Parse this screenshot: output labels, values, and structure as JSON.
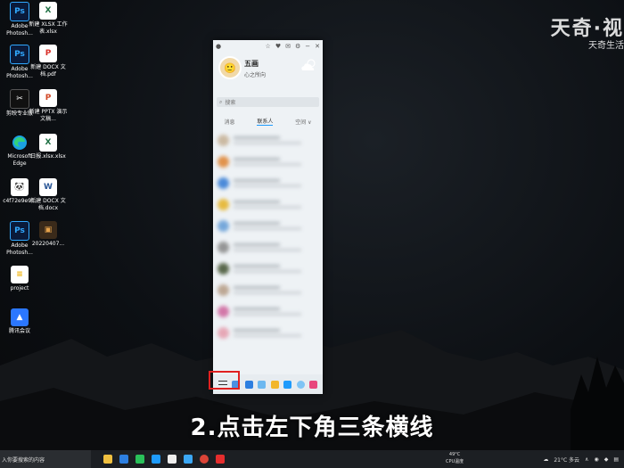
{
  "desktop": {
    "icons": [
      {
        "label": "Adobe Photosh...",
        "icon": "photoshop-icon",
        "glyph": "Ps"
      },
      {
        "label": "新建 XLSX 工作表.xlsx",
        "icon": "excel-file-icon",
        "glyph": "X"
      },
      {
        "label": "Adobe Photosh...",
        "icon": "photoshop-icon",
        "glyph": "Ps"
      },
      {
        "label": "新建 DOCX 文档.pdf",
        "icon": "pdf-file-icon",
        "glyph": "P"
      },
      {
        "label": "剪映专业版",
        "icon": "capcut-icon",
        "glyph": "✂"
      },
      {
        "label": "新建 PPTX 演示文稿...",
        "icon": "powerpoint-file-icon",
        "glyph": "P"
      },
      {
        "label": "Microsoft Edge",
        "icon": "edge-icon",
        "glyph": "e"
      },
      {
        "label": "日报.xlsx.xlsx",
        "icon": "excel-file-icon",
        "glyph": "X"
      },
      {
        "label": "c4f72e9e9...",
        "icon": "panda-image-icon",
        "glyph": "🐼"
      },
      {
        "label": "新建 DOCX 文档.docx",
        "icon": "word-file-icon",
        "glyph": "W"
      },
      {
        "label": "Adobe Photosh...",
        "icon": "photoshop-icon",
        "glyph": "Ps"
      },
      {
        "label": "20220407...",
        "icon": "image-file-icon",
        "glyph": "▣"
      },
      {
        "label": "project",
        "icon": "project-file-icon",
        "glyph": "≡"
      },
      {
        "label": "腾讯会议",
        "icon": "tencent-meeting-icon",
        "glyph": "▲"
      }
    ]
  },
  "watermark": {
    "big": "天奇·视",
    "small": "天奇生活"
  },
  "qq": {
    "profile_name": "五画",
    "status": "心之所向",
    "search_placeholder": "搜索",
    "tabs": [
      "消息",
      "联系人",
      "空间 ∨"
    ]
  },
  "caption": "2.点击左下角三条横线",
  "taskbar": {
    "search_placeholder": "入你要搜索的内容",
    "cpu_temp": "49°C",
    "cpu_label": "CPU温度",
    "weather": "21°C 多云"
  },
  "colors": {
    "highlight": "#e02020",
    "qq_accent": "#1e9bfc"
  }
}
